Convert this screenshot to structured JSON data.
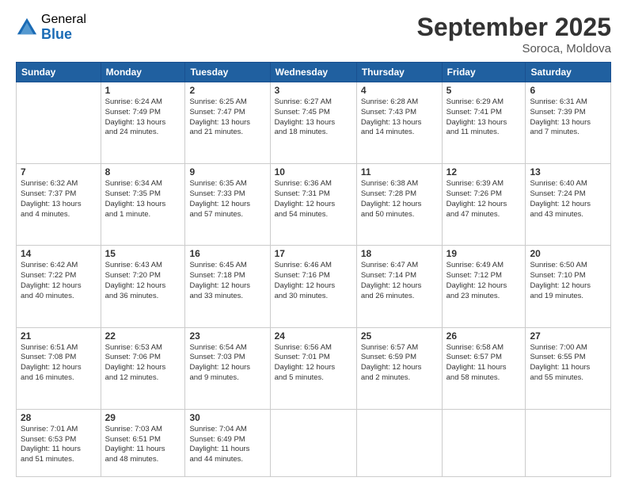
{
  "logo": {
    "general": "General",
    "blue": "Blue"
  },
  "title": {
    "month_year": "September 2025",
    "location": "Soroca, Moldova"
  },
  "weekdays": [
    "Sunday",
    "Monday",
    "Tuesday",
    "Wednesday",
    "Thursday",
    "Friday",
    "Saturday"
  ],
  "weeks": [
    [
      {
        "day": "",
        "info": ""
      },
      {
        "day": "1",
        "info": "Sunrise: 6:24 AM\nSunset: 7:49 PM\nDaylight: 13 hours\nand 24 minutes."
      },
      {
        "day": "2",
        "info": "Sunrise: 6:25 AM\nSunset: 7:47 PM\nDaylight: 13 hours\nand 21 minutes."
      },
      {
        "day": "3",
        "info": "Sunrise: 6:27 AM\nSunset: 7:45 PM\nDaylight: 13 hours\nand 18 minutes."
      },
      {
        "day": "4",
        "info": "Sunrise: 6:28 AM\nSunset: 7:43 PM\nDaylight: 13 hours\nand 14 minutes."
      },
      {
        "day": "5",
        "info": "Sunrise: 6:29 AM\nSunset: 7:41 PM\nDaylight: 13 hours\nand 11 minutes."
      },
      {
        "day": "6",
        "info": "Sunrise: 6:31 AM\nSunset: 7:39 PM\nDaylight: 13 hours\nand 7 minutes."
      }
    ],
    [
      {
        "day": "7",
        "info": "Sunrise: 6:32 AM\nSunset: 7:37 PM\nDaylight: 13 hours\nand 4 minutes."
      },
      {
        "day": "8",
        "info": "Sunrise: 6:34 AM\nSunset: 7:35 PM\nDaylight: 13 hours\nand 1 minute."
      },
      {
        "day": "9",
        "info": "Sunrise: 6:35 AM\nSunset: 7:33 PM\nDaylight: 12 hours\nand 57 minutes."
      },
      {
        "day": "10",
        "info": "Sunrise: 6:36 AM\nSunset: 7:31 PM\nDaylight: 12 hours\nand 54 minutes."
      },
      {
        "day": "11",
        "info": "Sunrise: 6:38 AM\nSunset: 7:28 PM\nDaylight: 12 hours\nand 50 minutes."
      },
      {
        "day": "12",
        "info": "Sunrise: 6:39 AM\nSunset: 7:26 PM\nDaylight: 12 hours\nand 47 minutes."
      },
      {
        "day": "13",
        "info": "Sunrise: 6:40 AM\nSunset: 7:24 PM\nDaylight: 12 hours\nand 43 minutes."
      }
    ],
    [
      {
        "day": "14",
        "info": "Sunrise: 6:42 AM\nSunset: 7:22 PM\nDaylight: 12 hours\nand 40 minutes."
      },
      {
        "day": "15",
        "info": "Sunrise: 6:43 AM\nSunset: 7:20 PM\nDaylight: 12 hours\nand 36 minutes."
      },
      {
        "day": "16",
        "info": "Sunrise: 6:45 AM\nSunset: 7:18 PM\nDaylight: 12 hours\nand 33 minutes."
      },
      {
        "day": "17",
        "info": "Sunrise: 6:46 AM\nSunset: 7:16 PM\nDaylight: 12 hours\nand 30 minutes."
      },
      {
        "day": "18",
        "info": "Sunrise: 6:47 AM\nSunset: 7:14 PM\nDaylight: 12 hours\nand 26 minutes."
      },
      {
        "day": "19",
        "info": "Sunrise: 6:49 AM\nSunset: 7:12 PM\nDaylight: 12 hours\nand 23 minutes."
      },
      {
        "day": "20",
        "info": "Sunrise: 6:50 AM\nSunset: 7:10 PM\nDaylight: 12 hours\nand 19 minutes."
      }
    ],
    [
      {
        "day": "21",
        "info": "Sunrise: 6:51 AM\nSunset: 7:08 PM\nDaylight: 12 hours\nand 16 minutes."
      },
      {
        "day": "22",
        "info": "Sunrise: 6:53 AM\nSunset: 7:06 PM\nDaylight: 12 hours\nand 12 minutes."
      },
      {
        "day": "23",
        "info": "Sunrise: 6:54 AM\nSunset: 7:03 PM\nDaylight: 12 hours\nand 9 minutes."
      },
      {
        "day": "24",
        "info": "Sunrise: 6:56 AM\nSunset: 7:01 PM\nDaylight: 12 hours\nand 5 minutes."
      },
      {
        "day": "25",
        "info": "Sunrise: 6:57 AM\nSunset: 6:59 PM\nDaylight: 12 hours\nand 2 minutes."
      },
      {
        "day": "26",
        "info": "Sunrise: 6:58 AM\nSunset: 6:57 PM\nDaylight: 11 hours\nand 58 minutes."
      },
      {
        "day": "27",
        "info": "Sunrise: 7:00 AM\nSunset: 6:55 PM\nDaylight: 11 hours\nand 55 minutes."
      }
    ],
    [
      {
        "day": "28",
        "info": "Sunrise: 7:01 AM\nSunset: 6:53 PM\nDaylight: 11 hours\nand 51 minutes."
      },
      {
        "day": "29",
        "info": "Sunrise: 7:03 AM\nSunset: 6:51 PM\nDaylight: 11 hours\nand 48 minutes."
      },
      {
        "day": "30",
        "info": "Sunrise: 7:04 AM\nSunset: 6:49 PM\nDaylight: 11 hours\nand 44 minutes."
      },
      {
        "day": "",
        "info": ""
      },
      {
        "day": "",
        "info": ""
      },
      {
        "day": "",
        "info": ""
      },
      {
        "day": "",
        "info": ""
      }
    ]
  ]
}
